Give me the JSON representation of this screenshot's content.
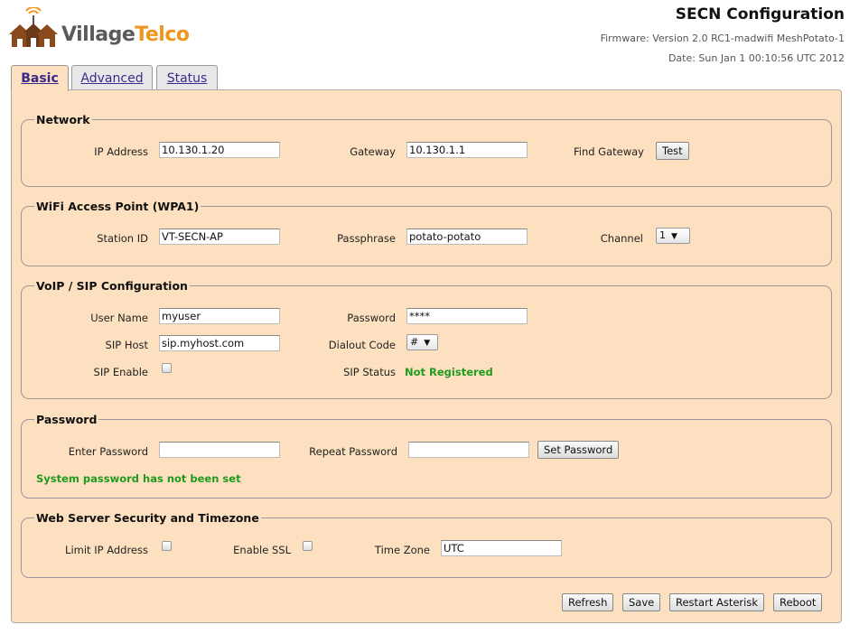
{
  "header": {
    "logo_village": "Village",
    "logo_telco": "Telco",
    "title": "SECN Configuration",
    "firmware": "Firmware: Version 2.0 RC1-madwifi MeshPotato-1",
    "date": "Date: Sun Jan 1 00:10:56 UTC 2012"
  },
  "tabs": [
    {
      "label": "Basic",
      "active": true
    },
    {
      "label": "Advanced",
      "active": false
    },
    {
      "label": "Status",
      "active": false
    }
  ],
  "network": {
    "legend": "Network",
    "ip_label": "IP Address",
    "ip_value": "10.130.1.20",
    "gateway_label": "Gateway",
    "gateway_value": "10.130.1.1",
    "find_gateway_label": "Find Gateway",
    "test_button": "Test"
  },
  "wifi": {
    "legend": "WiFi Access Point (WPA1)",
    "station_label": "Station ID",
    "station_value": "VT-SECN-AP",
    "passphrase_label": "Passphrase",
    "passphrase_value": "potato-potato",
    "channel_label": "Channel",
    "channel_value": "1"
  },
  "voip": {
    "legend": "VoIP / SIP Configuration",
    "user_label": "User Name",
    "user_value": "myuser",
    "password_label": "Password",
    "password_value": "****",
    "host_label": "SIP Host",
    "host_value": "sip.myhost.com",
    "dialout_label": "Dialout Code",
    "dialout_value": "#",
    "enable_label": "SIP Enable",
    "status_label": "SIP Status",
    "status_value": "Not Registered"
  },
  "password": {
    "legend": "Password",
    "enter_label": "Enter Password",
    "repeat_label": "Repeat Password",
    "set_button": "Set Password",
    "message": "System password has not been set"
  },
  "websec": {
    "legend": "Web Server Security and Timezone",
    "limit_ip_label": "Limit IP Address",
    "ssl_label": "Enable SSL",
    "tz_label": "Time Zone",
    "tz_value": "UTC"
  },
  "actions": {
    "refresh": "Refresh",
    "save": "Save",
    "restart": "Restart Asterisk",
    "reboot": "Reboot"
  },
  "colors": {
    "panel_bg": "#fde0bf",
    "status_green": "#1e9b1e",
    "logo_orange": "#f0961e"
  }
}
